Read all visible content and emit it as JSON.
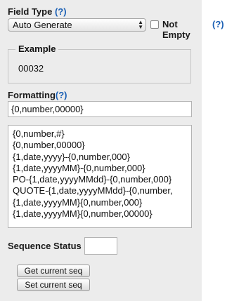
{
  "field_type": {
    "label": "Field Type",
    "help": "(?)",
    "selected": "Auto Generate",
    "not_empty_label": "Not Empty",
    "not_empty_checked": false,
    "not_empty_help": "(?)"
  },
  "example": {
    "legend": "Example",
    "value": "00032"
  },
  "formatting": {
    "label": "Formatting",
    "help": "(?)",
    "value": "{0,number,00000}",
    "options": [
      "{0,number,#}",
      "{0,number,00000}",
      "{1,date,yyyy}-{0,number,000}",
      "{1,date,yyyyMM}-{0,number,000}",
      "PO-{1,date,yyyyMMdd}-{0,number,000}",
      "QUOTE-{1,date,yyyyMMdd}-{0,number,",
      "{1,date,yyyyMM}{0,number,000}",
      "{1,date,yyyyMM}{0,number,00000}"
    ]
  },
  "sequence": {
    "label": "Sequence Status",
    "value": "",
    "get_button": "Get current seq",
    "set_button": "Set current seq"
  },
  "colors": {
    "panel_bg": "#ececec",
    "help_link": "#1a5fb4"
  }
}
